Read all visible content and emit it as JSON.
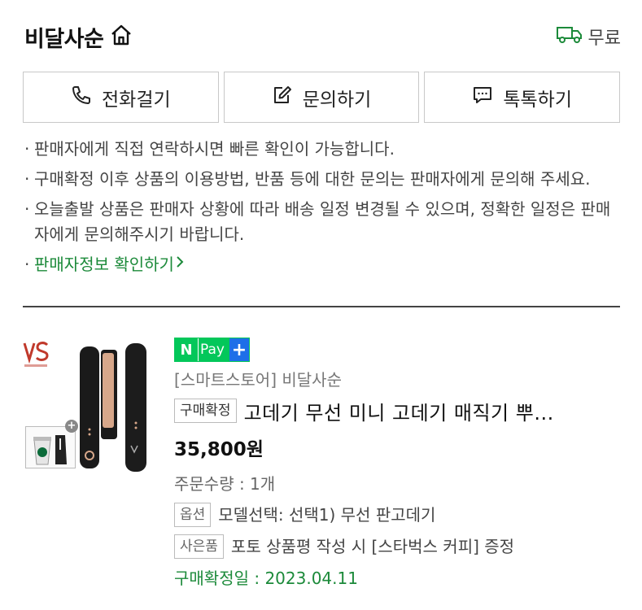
{
  "header": {
    "store_name": "비달사순",
    "shipping_label": "무료",
    "home_icon": "home-icon",
    "truck_icon": "truck-icon"
  },
  "actions": [
    {
      "label": "전화걸기",
      "icon": "phone-icon"
    },
    {
      "label": "문의하기",
      "icon": "edit-icon"
    },
    {
      "label": "톡톡하기",
      "icon": "chat-icon"
    }
  ],
  "notes": [
    "판매자에게 직접 연락하시면 빠른 확인이 가능합니다.",
    "구매확정 이후 상품의 이용방법, 반품 등에 대한 문의는 판매자에게 문의해 주세요.",
    "오늘출발 상품은 판매자 상황에 따라 배송 일정 변경될 수 있으며, 정확한 일정은 판매자에게 문의해주시기 바랍니다."
  ],
  "seller_info_link": "판매자정보 확인하기",
  "order": {
    "pay_badge_n": "N",
    "pay_badge_text": "Pay",
    "pay_badge_plus": "+",
    "store_line": "[스마트스토어] 비달사순",
    "status_tag": "구매확정",
    "title": "고데기 무선 미니 고데기 매직기 뿌...",
    "price": "35,800원",
    "quantity": "주문수량 : 1개",
    "option_tag": "옵션",
    "option_value": "모델선택: 선택1) 무선 판고데기",
    "gift_tag": "사은품",
    "gift_value": "포토 상품평 작성 시 [스타벅스 커피] 증정",
    "confirm_date": "구매확정일 : 2023.04.11"
  },
  "colors": {
    "accent_green": "#1c8a3a",
    "npay_green": "#03c75a",
    "npay_blue": "#1e6fe8"
  }
}
